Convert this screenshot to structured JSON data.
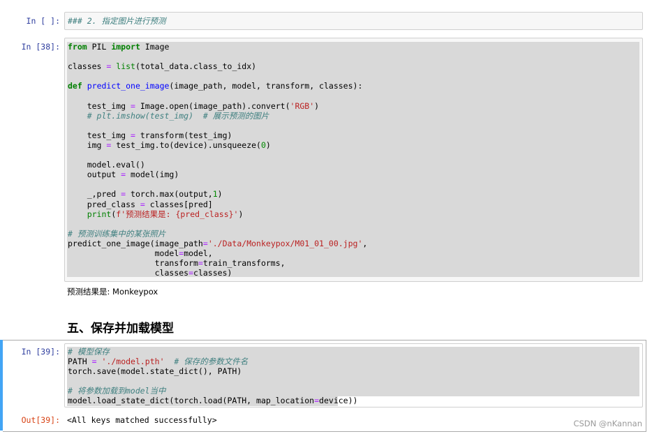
{
  "cell1": {
    "prompt": "In [ ]:",
    "code": "### 2. 指定图片进行预测"
  },
  "cell2": {
    "prompt": "In [38]:",
    "lines": [
      "from PIL import Image",
      "",
      "classes = list(total_data.class_to_idx)",
      "",
      "def predict_one_image(image_path, model, transform, classes):",
      "",
      "    test_img = Image.open(image_path).convert('RGB')",
      "    # plt.imshow(test_img)  # 展示预测的图片",
      "",
      "    test_img = transform(test_img)",
      "    img = test_img.to(device).unsqueeze(0)",
      "",
      "    model.eval()",
      "    output = model(img)",
      "",
      "    _,pred = torch.max(output,1)",
      "    pred_class = classes[pred]",
      "    print(f'预测结果是: {pred_class}')",
      "",
      "# 预测训练集中的某张照片",
      "predict_one_image(image_path='./Data/Monkeypox/M01_01_00.jpg',",
      "                  model=model,",
      "                  transform=train_transforms,",
      "                  classes=classes)"
    ],
    "output": "预测结果是: Monkeypox"
  },
  "markdown": {
    "heading": "五、保存并加载模型"
  },
  "cell3": {
    "prompt": "In [39]:",
    "lines": [
      "# 模型保存",
      "PATH = './model.pth'  # 保存的参数文件名",
      "torch.save(model.state_dict(), PATH)",
      "",
      "# 将参数加载到model当中",
      "model.load_state_dict(torch.load(PATH, map_location=device))"
    ],
    "out_prompt": "Out[39]:",
    "output": "<All keys matched successfully>"
  },
  "watermark": "CSDN @nKannan",
  "colors": {
    "input_prompt": "#303f9f",
    "output_prompt": "#d84315",
    "selection_bar": "#42a5f5",
    "keyword": "#008000",
    "string": "#ba2121",
    "comment": "#408080"
  }
}
